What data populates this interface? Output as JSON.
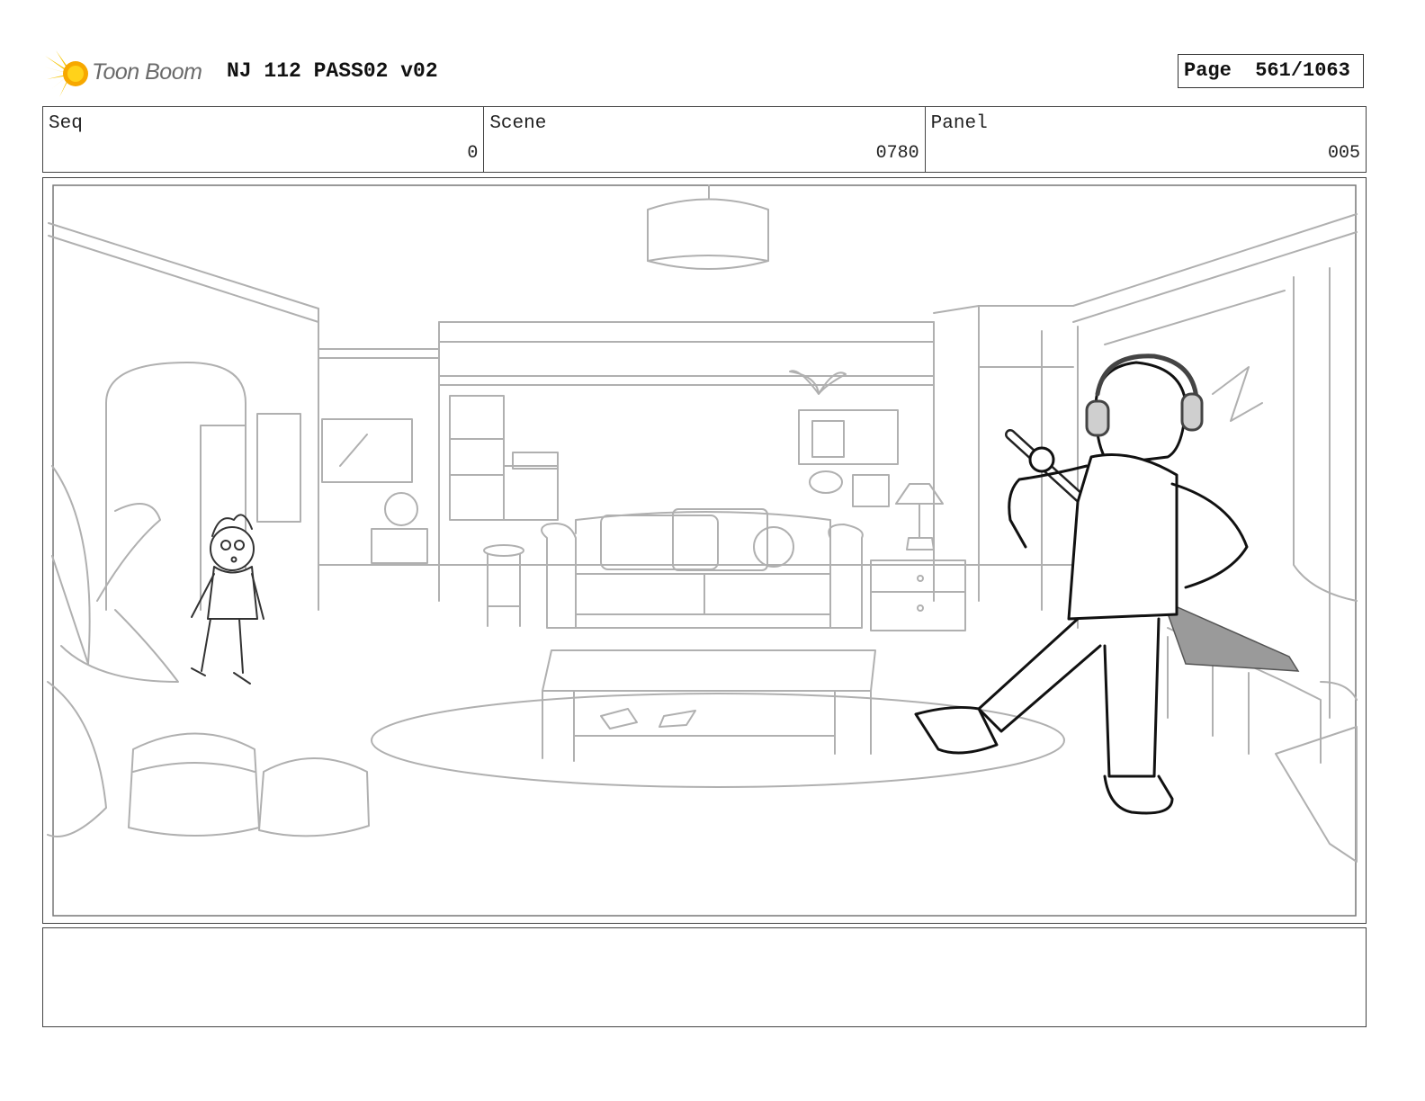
{
  "header": {
    "logo_text": "Toon Boom",
    "doc_title": "NJ 112 PASS02 v02",
    "page_label": "Page",
    "page_value": "561/1063"
  },
  "info": {
    "seq_label": "Seq",
    "seq_value": "0",
    "scene_label": "Scene",
    "scene_value": "0780",
    "panel_label": "Panel",
    "panel_value": "005"
  },
  "notes": {
    "text": ""
  }
}
